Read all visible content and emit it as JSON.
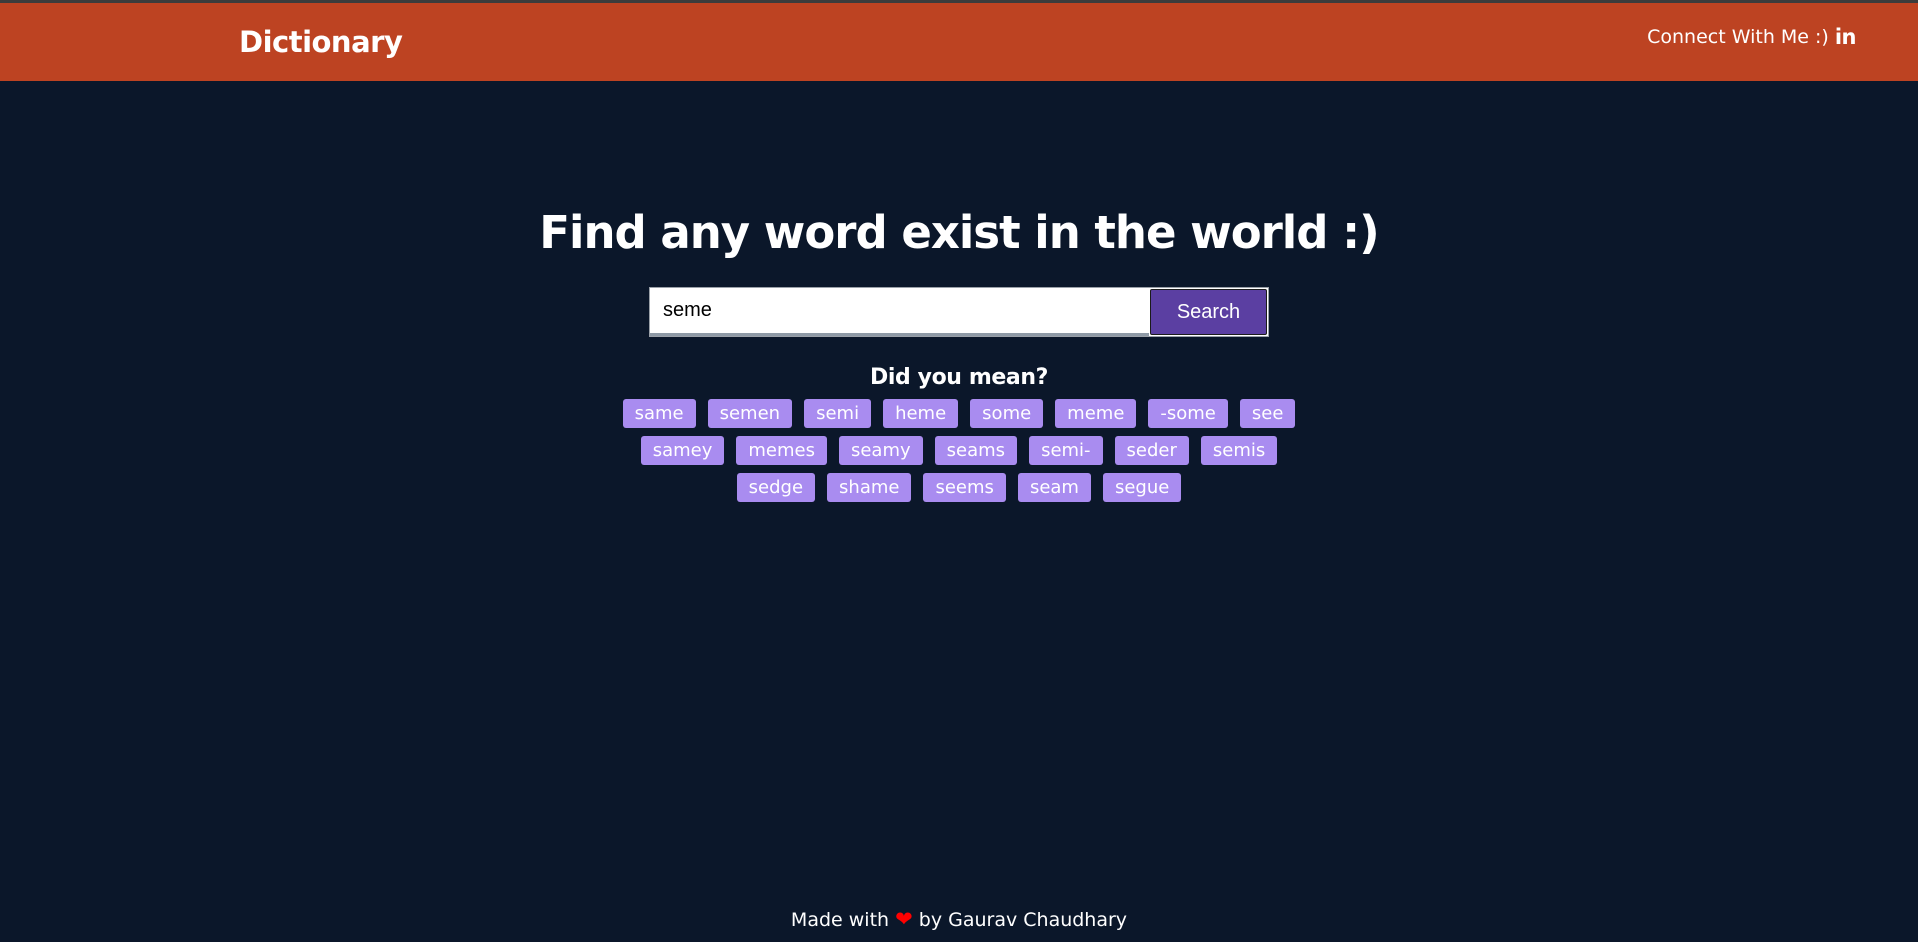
{
  "header": {
    "brand": "Dictionary",
    "connect_label": "Connect With Me :)",
    "linkedin_icon_text": "in"
  },
  "hero": {
    "title": "Find any word exist in the world :)"
  },
  "search": {
    "value": "seme",
    "button_label": "Search"
  },
  "suggestions": {
    "title": "Did you mean?",
    "rows": [
      [
        "same",
        "semen",
        "semi",
        "heme",
        "some",
        "meme",
        "-some",
        "see"
      ],
      [
        "samey",
        "memes",
        "seamy",
        "seams",
        "semi-",
        "seder",
        "semis"
      ],
      [
        "sedge",
        "shame",
        "seems",
        "seam",
        "segue"
      ]
    ]
  },
  "footer": {
    "prefix": "Made with",
    "heart_icon": "heart-icon",
    "suffix": "by Gaurav Chaudhary"
  },
  "colors": {
    "background": "#0b172a",
    "header": "#bd4322",
    "chip": "#a98cf0",
    "button": "#5b3fa2",
    "heart": "#ff0000"
  }
}
